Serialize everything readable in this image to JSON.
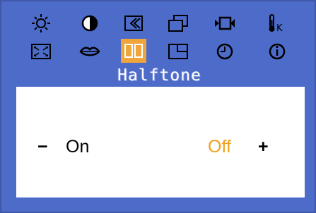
{
  "menu": {
    "icons": [
      {
        "name": "brightness-icon"
      },
      {
        "name": "contrast-icon"
      },
      {
        "name": "image-setup-icon"
      },
      {
        "name": "position-icon"
      },
      {
        "name": "video-input-icon"
      },
      {
        "name": "color-temperature-icon",
        "label": "K"
      },
      {
        "name": "image-size-icon"
      },
      {
        "name": "lips-icon"
      },
      {
        "name": "halftone-icon",
        "selected": true
      },
      {
        "name": "pip-icon"
      },
      {
        "name": "clock-icon"
      },
      {
        "name": "information-icon"
      }
    ]
  },
  "title": "Halftone",
  "setting": {
    "minus": "−",
    "on_label": "On",
    "off_label": "Off",
    "plus": "+",
    "selected": "Off"
  },
  "colors": {
    "background": "#4d6bc9",
    "highlight": "#f0a53b",
    "selected_text": "#f0a020"
  }
}
